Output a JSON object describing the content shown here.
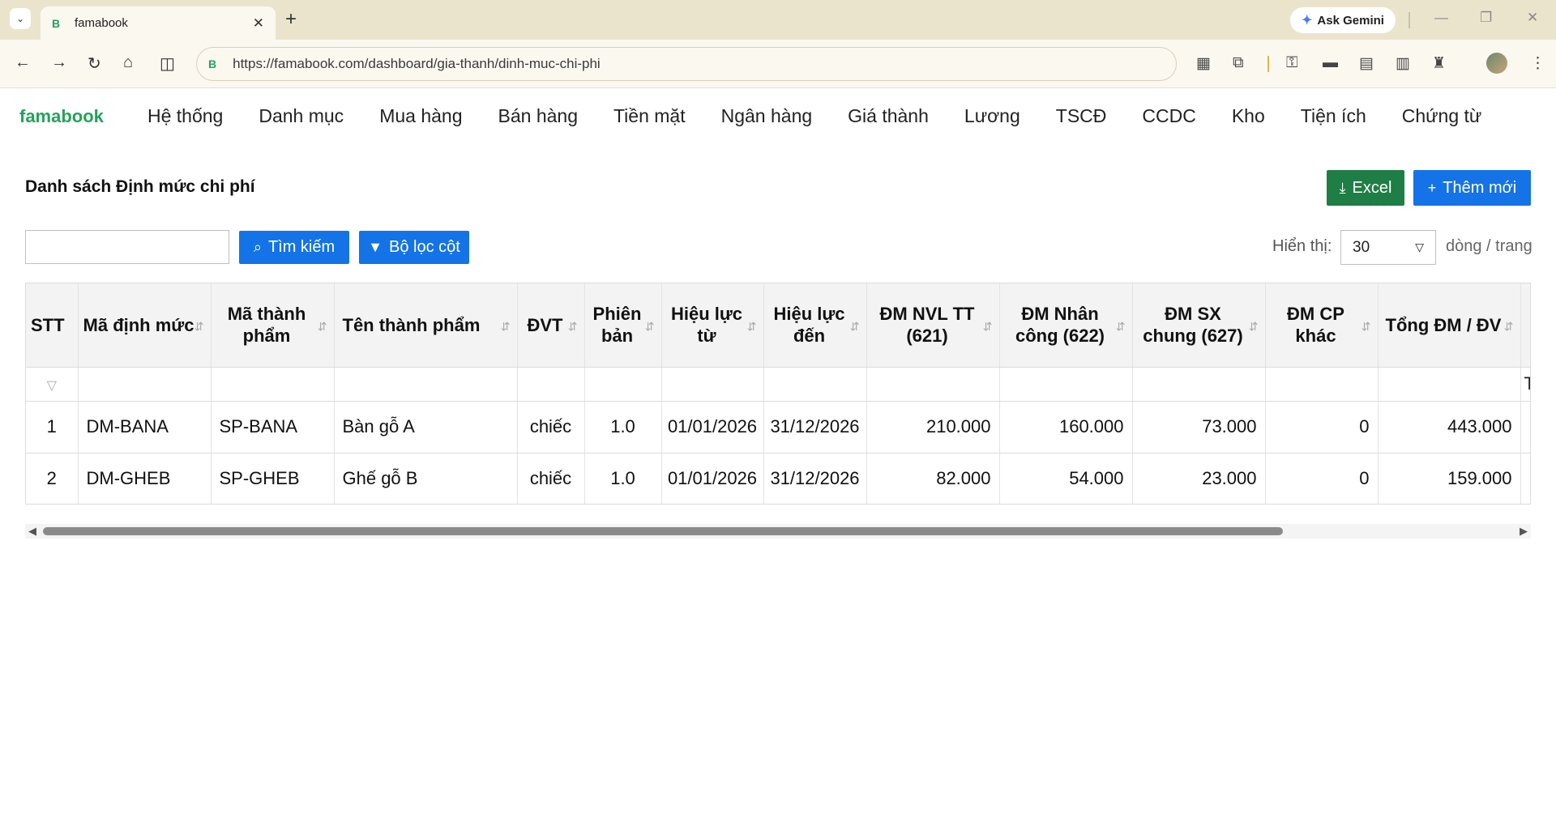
{
  "browser": {
    "tab_title": "famabook",
    "tab_favicon": "B",
    "url": "https://famabook.com/dashboard/gia-thanh/dinh-muc-chi-phi",
    "gemini_label": "Ask Gemini"
  },
  "app": {
    "brand": "famabook",
    "menu": [
      "Hệ thống",
      "Danh mục",
      "Mua hàng",
      "Bán hàng",
      "Tiền mặt",
      "Ngân hàng",
      "Giá thành",
      "Lương",
      "TSCĐ",
      "CCDC",
      "Kho",
      "Tiện ích",
      "Chứng từ"
    ]
  },
  "page": {
    "title": "Danh sách Định mức chi phí",
    "excel_label": "Excel",
    "add_label": "Thêm mới",
    "search_label": "Tìm kiếm",
    "search_placeholder": "",
    "filter_label": "Bộ lọc cột",
    "show_label": "Hiển thị:",
    "page_size": "30",
    "per_page_label": "dòng / trang"
  },
  "table": {
    "columns": [
      "STT",
      "Mã định mức",
      "Mã thành phẩm",
      "Tên thành phẩm",
      "ĐVT",
      "Phiên bản",
      "Hiệu lực từ",
      "Hiệu lực đến",
      "ĐM NVL TT (621)",
      "ĐM Nhân công (622)",
      "ĐM SX chung (627)",
      "ĐM CP khác",
      "Tổng ĐM / ĐV"
    ],
    "extra_filter_text": "T",
    "rows": [
      {
        "stt": "1",
        "ma_dm": "DM-BANA",
        "ma_tp": "SP-BANA",
        "ten_tp": "Bàn gỗ A",
        "dvt": "chiếc",
        "phien_ban": "1.0",
        "tu": "01/01/2026",
        "den": "31/12/2026",
        "nvl": "210.000",
        "nc": "160.000",
        "sxc": "73.000",
        "khac": "0",
        "tong": "443.000"
      },
      {
        "stt": "2",
        "ma_dm": "DM-GHEB",
        "ma_tp": "SP-GHEB",
        "ten_tp": "Ghế gỗ B",
        "dvt": "chiếc",
        "phien_ban": "1.0",
        "tu": "01/01/2026",
        "den": "31/12/2026",
        "nvl": "82.000",
        "nc": "54.000",
        "sxc": "23.000",
        "khac": "0",
        "tong": "159.000"
      }
    ]
  },
  "colors": {
    "brand_green": "#22a35a",
    "primary_blue": "#1473e6",
    "excel_green": "#1e7e45",
    "total_green": "#3c8a1f"
  }
}
